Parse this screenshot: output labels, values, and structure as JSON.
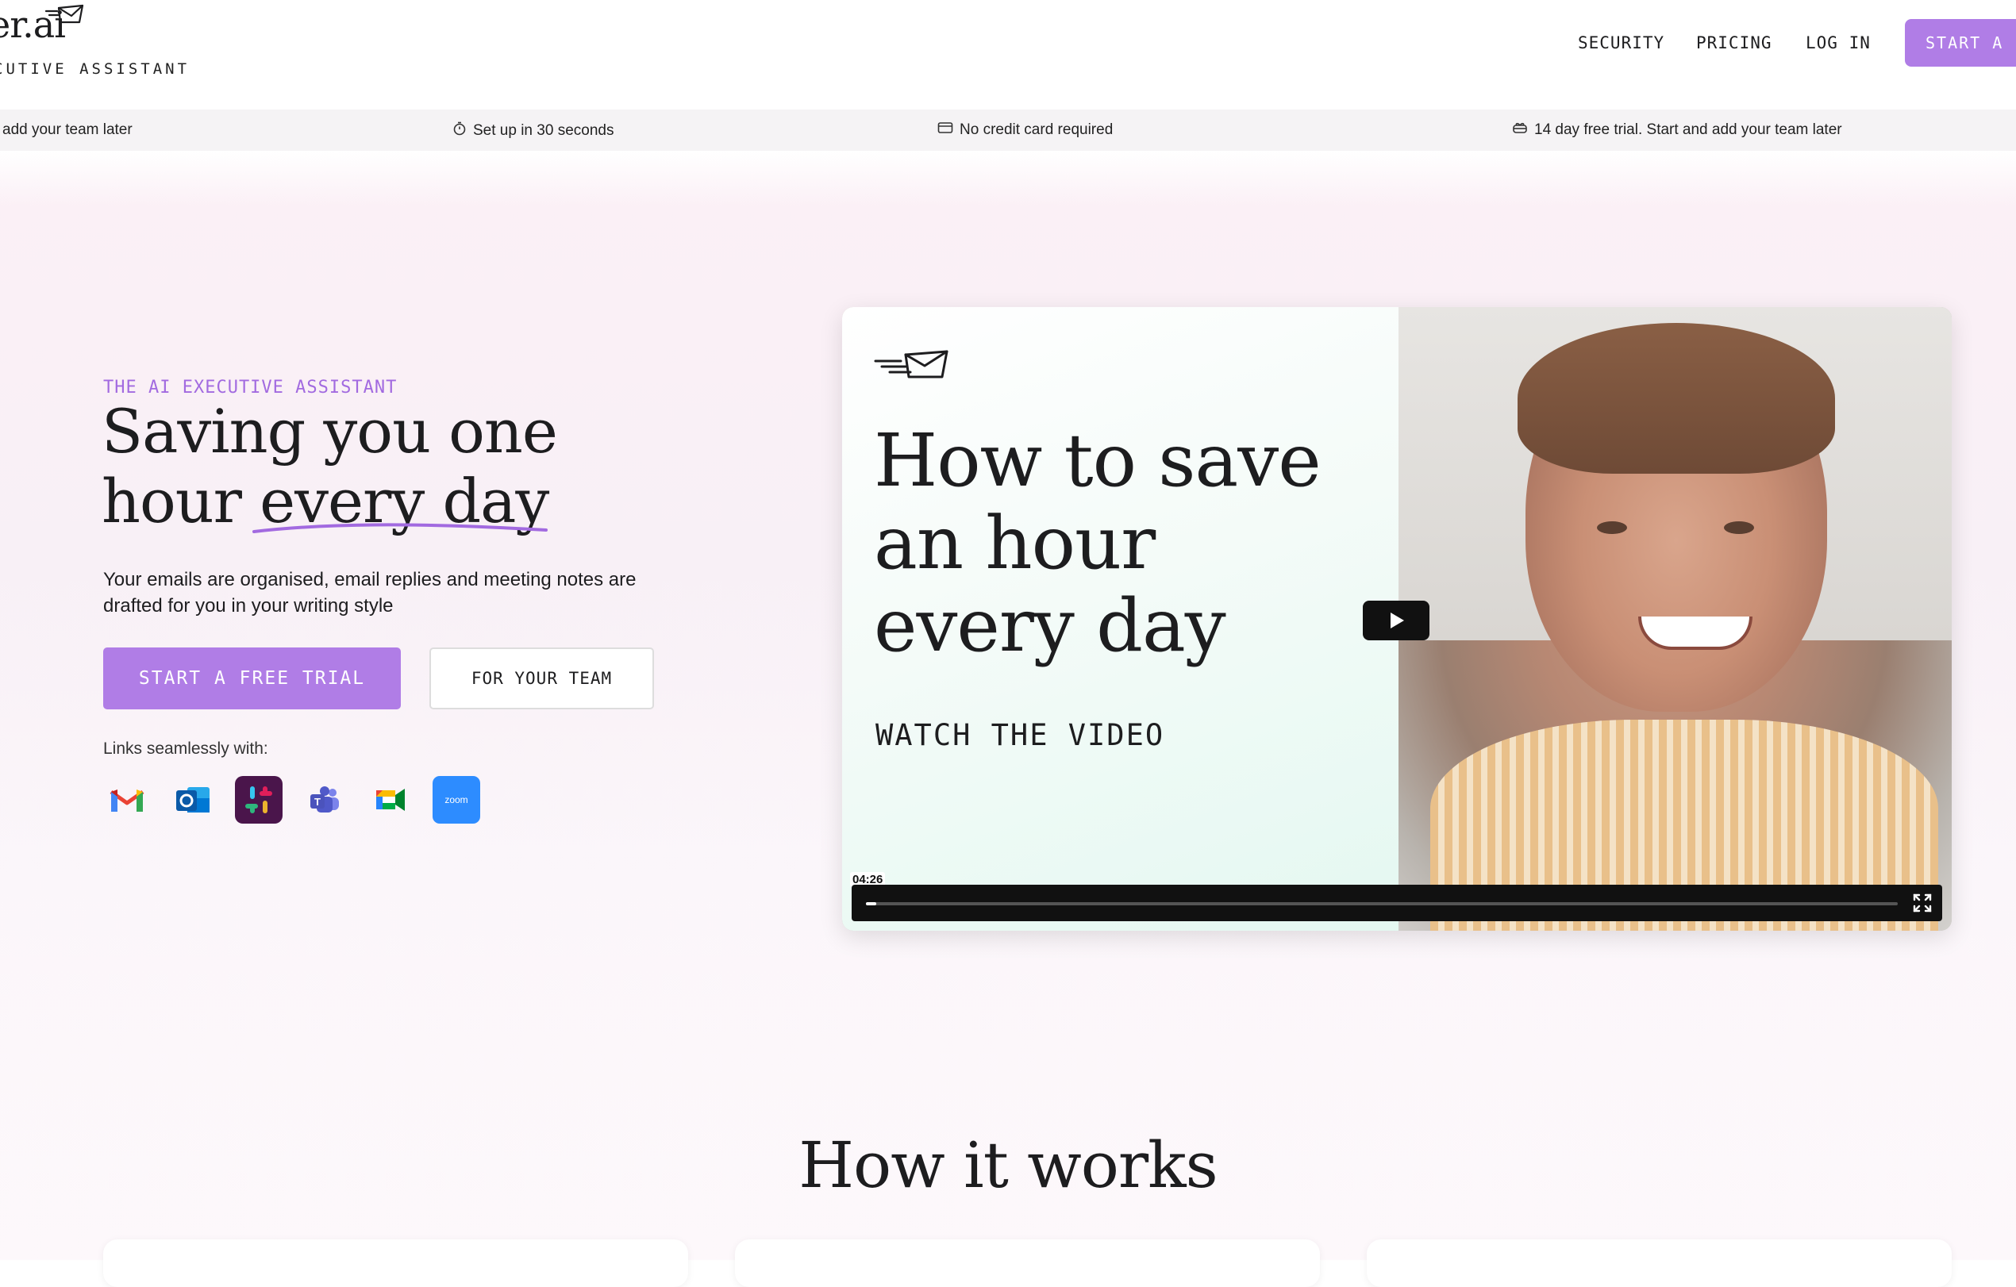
{
  "header": {
    "logo_text": "er.ai",
    "logo_tagline": "CUTIVE ASSISTANT",
    "nav": [
      "SECURITY",
      "PRICING",
      "LOG IN"
    ],
    "cta": "START A FREE TRIAL"
  },
  "ticker": [
    {
      "icon": "users-icon",
      "text": "add your team later"
    },
    {
      "icon": "stopwatch-icon",
      "text": "Set up in 30 seconds"
    },
    {
      "icon": "credit-card-icon",
      "text": "No credit card required"
    },
    {
      "icon": "gift-icon",
      "text": "14 day free trial. Start and add your team later"
    }
  ],
  "hero": {
    "eyebrow": "THE AI EXECUTIVE ASSISTANT",
    "headline_line1": "Saving you one",
    "headline_line2": "hour every day",
    "subtext": "Your emails are organised, email replies and meeting notes are drafted for you in your writing style",
    "primary_button": "START A FREE TRIAL",
    "secondary_button": "FOR YOUR TEAM",
    "links_label": "Links seamlessly with:",
    "integrations": [
      "gmail-icon",
      "outlook-icon",
      "slack-icon",
      "teams-icon",
      "google-meet-icon",
      "zoom-icon"
    ],
    "zoom_label": "zoom"
  },
  "video": {
    "title_line1": "How to save",
    "title_line2": "an hour",
    "title_line3": "every day",
    "subtitle": "WATCH THE VIDEO",
    "duration": "04:26",
    "progress": 0.0
  },
  "section": {
    "title": "How it works"
  },
  "colors": {
    "accent": "#b07de6",
    "eyebrow": "#a26ae0",
    "text": "#1d1d1f"
  }
}
